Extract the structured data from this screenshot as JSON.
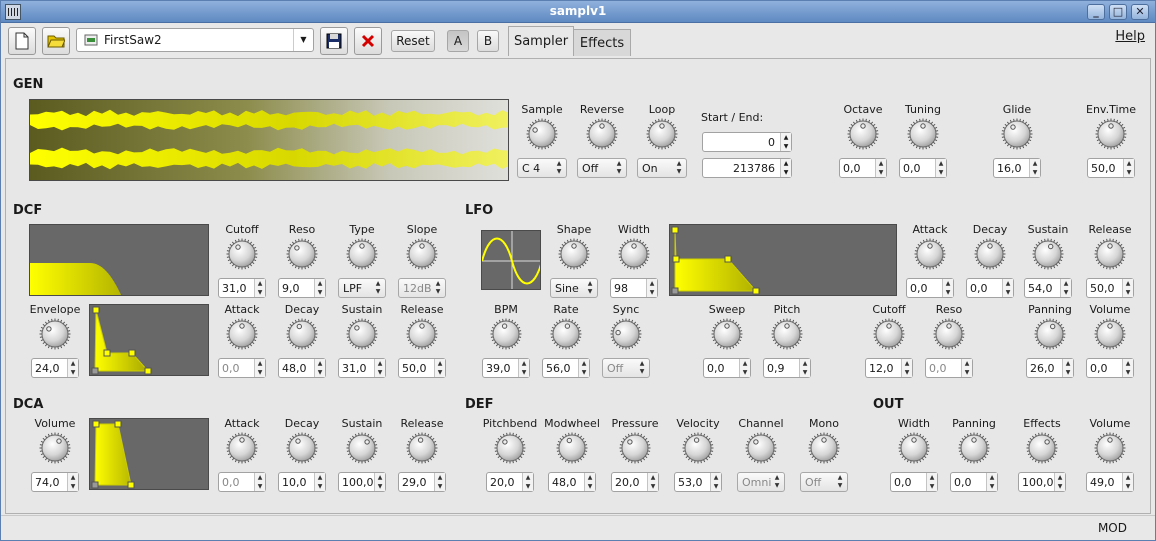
{
  "window": {
    "title": "samplv1"
  },
  "toolbar": {
    "preset_name": "FirstSaw2",
    "reset_label": "Reset",
    "a_label": "A",
    "b_label": "B",
    "tabs": [
      {
        "label": "Sampler",
        "active": true
      },
      {
        "label": "Effects",
        "active": false
      }
    ],
    "help_label": "Help"
  },
  "status": {
    "mod": "MOD"
  },
  "colors": {
    "accent": "#e8e800",
    "display_bg": "#686868"
  },
  "sections": {
    "gen": "GEN",
    "dcf": "DCF",
    "lfo": "LFO",
    "dca": "DCA",
    "def": "DEF",
    "out": "OUT"
  },
  "gen": {
    "sample": {
      "label": "Sample",
      "value": "C 4"
    },
    "reverse": {
      "label": "Reverse",
      "value": "Off"
    },
    "loop": {
      "label": "Loop",
      "value": "On"
    },
    "start_end_label": "Start / End:",
    "start": "0",
    "end": "213786",
    "octave": {
      "label": "Octave",
      "value": "0,0"
    },
    "tuning": {
      "label": "Tuning",
      "value": "0,0"
    },
    "glide": {
      "label": "Glide",
      "value": "16,0"
    },
    "envtime": {
      "label": "Env.Time",
      "value": "50,0"
    }
  },
  "dcf": {
    "cutoff": {
      "label": "Cutoff",
      "value": "31,0"
    },
    "reso": {
      "label": "Reso",
      "value": "9,0"
    },
    "type": {
      "label": "Type",
      "value": "LPF"
    },
    "slope": {
      "label": "Slope",
      "value": "12dB"
    },
    "envelope": {
      "label": "Envelope",
      "value": "24,0"
    },
    "attack": {
      "label": "Attack",
      "value": "0,0"
    },
    "decay": {
      "label": "Decay",
      "value": "48,0"
    },
    "sustain": {
      "label": "Sustain",
      "value": "31,0"
    },
    "release": {
      "label": "Release",
      "value": "50,0"
    }
  },
  "lfo": {
    "shape": {
      "label": "Shape",
      "value": "Sine"
    },
    "width": {
      "label": "Width",
      "value": "98"
    },
    "attack": {
      "label": "Attack",
      "value": "0,0"
    },
    "decay": {
      "label": "Decay",
      "value": "0,0"
    },
    "sustain": {
      "label": "Sustain",
      "value": "54,0"
    },
    "release": {
      "label": "Release",
      "value": "50,0"
    },
    "bpm": {
      "label": "BPM",
      "value": "39,0"
    },
    "rate": {
      "label": "Rate",
      "value": "56,0"
    },
    "sync": {
      "label": "Sync",
      "value": "Off"
    },
    "sweep": {
      "label": "Sweep",
      "value": "0,0"
    },
    "pitch": {
      "label": "Pitch",
      "value": "0,9"
    },
    "cutoff": {
      "label": "Cutoff",
      "value": "12,0"
    },
    "reso": {
      "label": "Reso",
      "value": "0,0"
    },
    "panning": {
      "label": "Panning",
      "value": "26,0"
    },
    "volume": {
      "label": "Volume",
      "value": "0,0"
    }
  },
  "dca": {
    "volume": {
      "label": "Volume",
      "value": "74,0"
    },
    "attack": {
      "label": "Attack",
      "value": "0,0"
    },
    "decay": {
      "label": "Decay",
      "value": "10,0"
    },
    "sustain": {
      "label": "Sustain",
      "value": "100,0"
    },
    "release": {
      "label": "Release",
      "value": "29,0"
    }
  },
  "def": {
    "pitchbend": {
      "label": "Pitchbend",
      "value": "20,0"
    },
    "modwheel": {
      "label": "Modwheel",
      "value": "48,0"
    },
    "pressure": {
      "label": "Pressure",
      "value": "20,0"
    },
    "velocity": {
      "label": "Velocity",
      "value": "53,0"
    },
    "channel": {
      "label": "Channel",
      "value": "Omni"
    },
    "mono": {
      "label": "Mono",
      "value": "Off"
    }
  },
  "out": {
    "width": {
      "label": "Width",
      "value": "0,0"
    },
    "panning": {
      "label": "Panning",
      "value": "0,0"
    },
    "effects": {
      "label": "Effects",
      "value": "100,0"
    },
    "volume": {
      "label": "Volume",
      "value": "49,0"
    }
  }
}
